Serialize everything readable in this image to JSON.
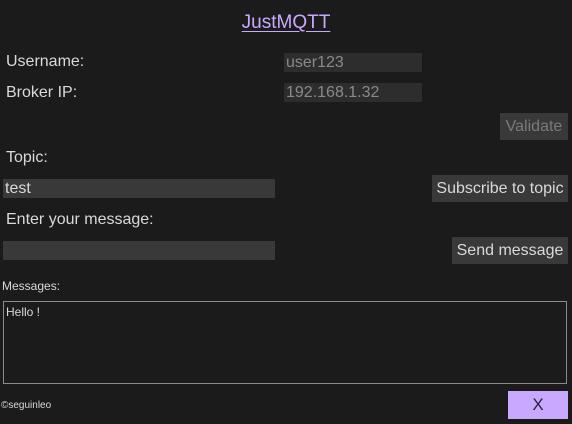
{
  "app": {
    "title": "JustMQTT",
    "credit": "©seguinleo"
  },
  "connection": {
    "username_label": "Username:",
    "username_value": "user123",
    "broker_label": "Broker IP:",
    "broker_value": "192.168.1.32",
    "validate_label": "Validate"
  },
  "topic": {
    "label": "Topic:",
    "value": "test",
    "subscribe_label": "Subscribe to topic"
  },
  "message": {
    "label": "Enter your message:",
    "value": "",
    "send_label": "Send message"
  },
  "messages": {
    "label": "Messages:",
    "content": "Hello !"
  },
  "close": {
    "label": "X"
  },
  "colors": {
    "background": "#1c1b1b",
    "accent": "#c9a9ff",
    "field": "#2e2d2d",
    "button": "#3a3939"
  }
}
